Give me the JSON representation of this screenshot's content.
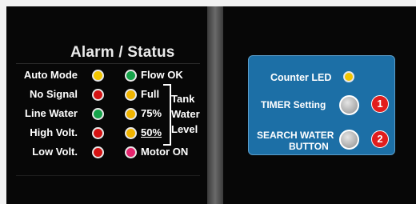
{
  "alarm_status": {
    "title": "Alarm / Status",
    "left_indicators": [
      {
        "label": "Auto Mode",
        "color": "#f2c500"
      },
      {
        "label": "No Signal",
        "color": "#d41313"
      },
      {
        "label": "Line Water",
        "color": "#16a34a"
      },
      {
        "label": "High Volt.",
        "color": "#d41313"
      },
      {
        "label": "Low Volt.",
        "color": "#d41313"
      }
    ],
    "right_indicators": [
      {
        "label": "Flow OK",
        "color": "#16a34a"
      },
      {
        "label": "Full",
        "color": "#f0b400"
      },
      {
        "label": "75%",
        "color": "#f0b400"
      },
      {
        "label": "50%",
        "color": "#f0b400"
      },
      {
        "label": "Motor ON",
        "color": "#e5256e"
      }
    ],
    "tank_level_label": [
      "Tank",
      "Water",
      "Level"
    ]
  },
  "control_panel": {
    "counter_led_label": "Counter LED",
    "counter_led_color": "#f2c500",
    "timer_label": "TIMER Setting",
    "timer_badge": "1",
    "search_label_line1": "SEARCH WATER",
    "search_label_line2": "BUTTON",
    "search_badge": "2",
    "panel_color": "#1c6fa6",
    "badge_color": "#e11d1d"
  }
}
